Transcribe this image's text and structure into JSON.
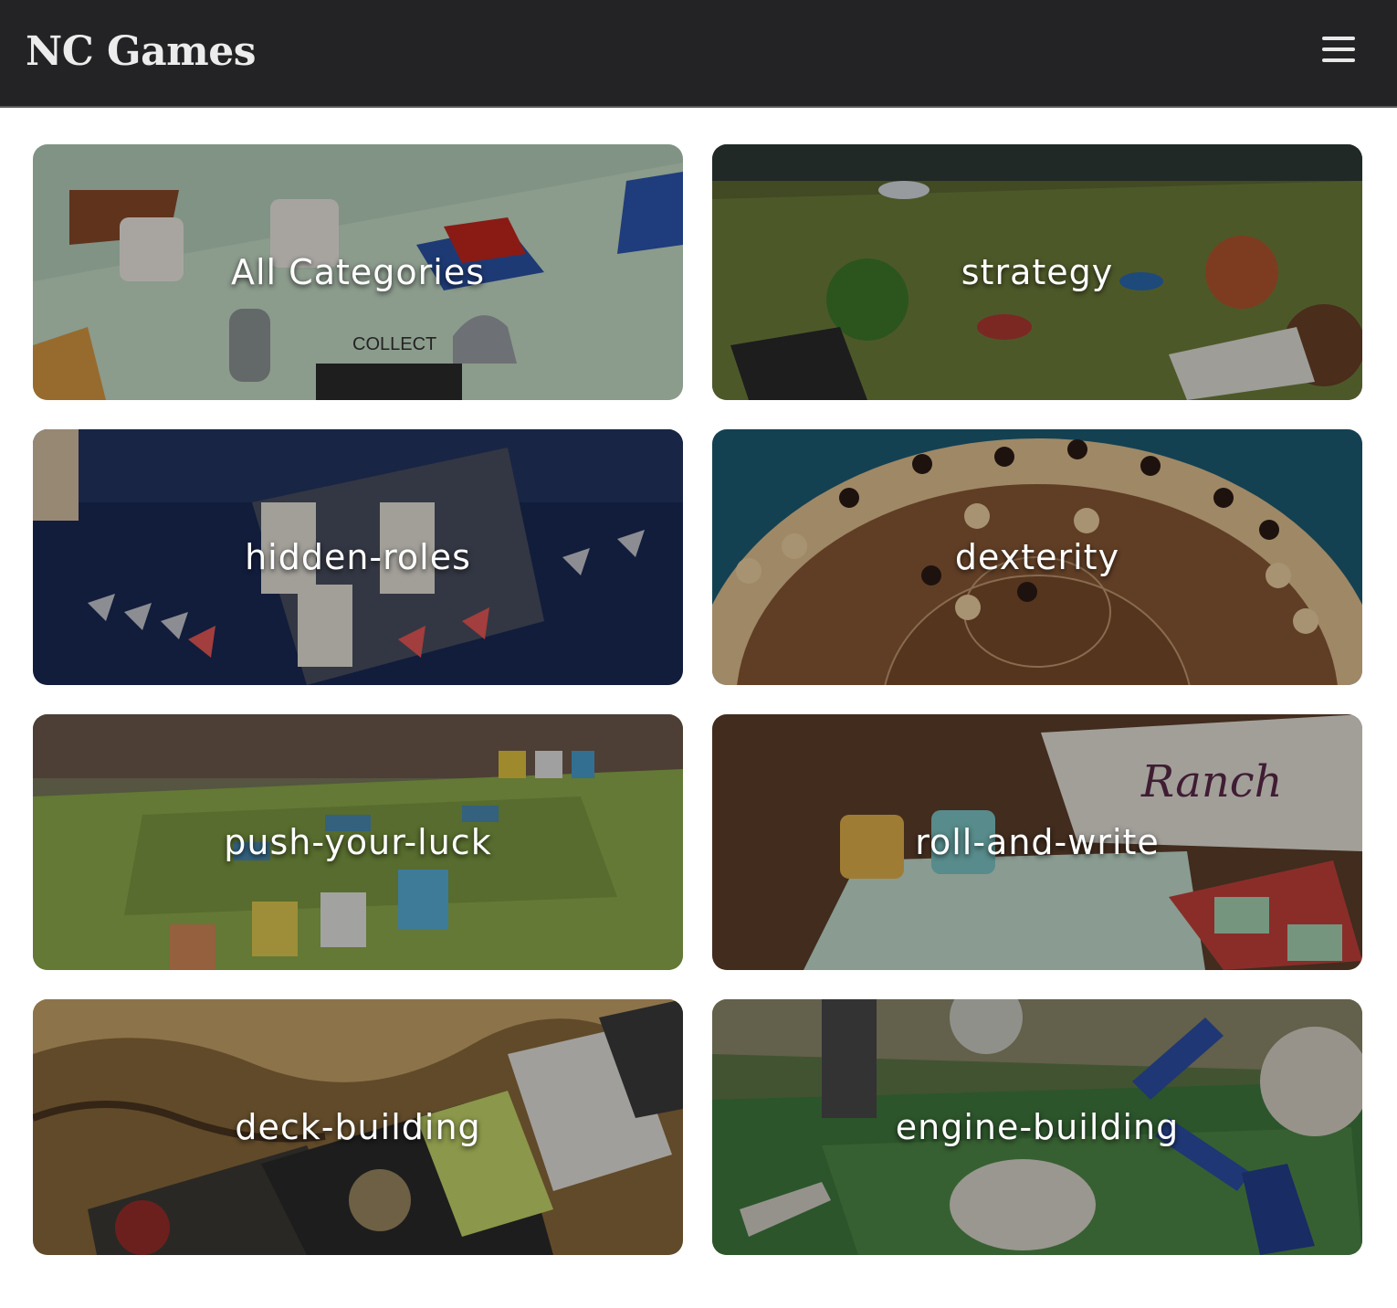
{
  "header": {
    "brand": "NC Games",
    "menu_icon": "hamburger-menu-icon"
  },
  "categories": [
    {
      "label": "All Categories",
      "image": "monopoly-board"
    },
    {
      "label": "strategy",
      "image": "fantasy-miniatures-map"
    },
    {
      "label": "hidden-roles",
      "image": "space-ships-board"
    },
    {
      "label": "dexterity",
      "image": "crokinole-board"
    },
    {
      "label": "push-your-luck",
      "image": "tile-map-meeples"
    },
    {
      "label": "roll-and-write",
      "image": "dice-and-score-sheet"
    },
    {
      "label": "deck-building",
      "image": "fantasy-card-game"
    },
    {
      "label": "engine-building",
      "image": "hex-map-roads"
    }
  ],
  "colors": {
    "header_bg": "#232325",
    "brand_text": "#ececec",
    "tile_label": "#ffffff"
  }
}
